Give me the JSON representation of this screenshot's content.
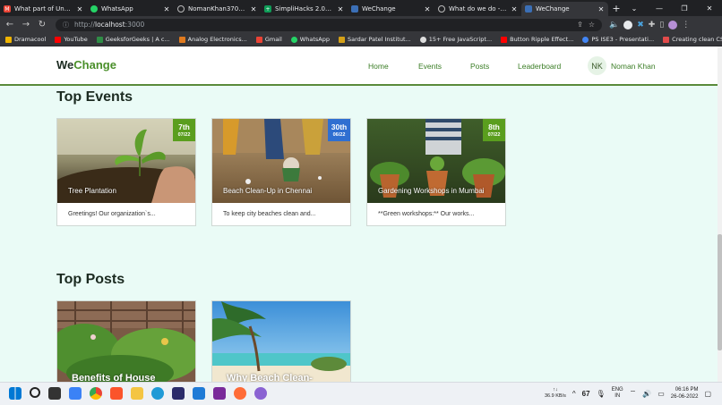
{
  "tabs": [
    {
      "title": "What part of Untitled",
      "icon": "gmail-icon",
      "color": "#ea4335"
    },
    {
      "title": "WhatsApp",
      "icon": "whatsapp-icon",
      "color": "#25d366"
    },
    {
      "title": "NomanKhan3701 (No",
      "icon": "github-icon",
      "color": "#333333"
    },
    {
      "title": "SimpliHacks 2.0 Sche",
      "icon": "sheets-icon",
      "color": "#0f9d58"
    },
    {
      "title": "WeChange",
      "icon": "site-icon",
      "color": "#3b6fb6"
    },
    {
      "title": "What do we do - Ga",
      "icon": "github-icon",
      "color": "#333333"
    },
    {
      "title": "WeChange",
      "icon": "site-icon",
      "color": "#3b6fb6"
    }
  ],
  "url": {
    "scheme": "http://",
    "host": "localhost",
    "port": ":3000"
  },
  "bookmarks": [
    {
      "label": "Dramacool",
      "color": "#f0b400"
    },
    {
      "label": "YouTube",
      "color": "#ff0000"
    },
    {
      "label": "GeeksforGeeks | A c...",
      "color": "#2f8d46"
    },
    {
      "label": "Analog Electronics...",
      "color": "#e07a1e"
    },
    {
      "label": "Gmail",
      "color": "#ea4335"
    },
    {
      "label": "WhatsApp",
      "color": "#25d366"
    },
    {
      "label": "Sardar Patel Institut...",
      "color": "#d4a017"
    },
    {
      "label": "15+ Free JavaScript...",
      "color": "#888888"
    },
    {
      "label": "Button Ripple Effect...",
      "color": "#ff0000"
    },
    {
      "label": "PS ISE3 - Presentati...",
      "color": "#4285f4"
    },
    {
      "label": "Creating clean CSS...",
      "color": "#e24b4b"
    }
  ],
  "site": {
    "brand_we": "We",
    "brand_change": "Change",
    "nav": [
      "Home",
      "Events",
      "Posts",
      "Leaderboard"
    ],
    "user": {
      "initials": "NK",
      "name": "Noman Khan"
    }
  },
  "sections": {
    "events_title": "Top Events",
    "posts_title": "Top Posts"
  },
  "events": [
    {
      "caption": "Tree Plantation",
      "day": "7th",
      "month": "07/22",
      "badge_color": "#5a9e1e",
      "desc": "Greetings! Our organization`s..."
    },
    {
      "caption": "Beach Clean-Up in Chennai",
      "day": "30th",
      "month": "06/22",
      "badge_color": "#2f6fd1",
      "desc": "To keep city beaches clean and..."
    },
    {
      "caption": "Gardening Workshops in Mumbai",
      "day": "8th",
      "month": "07/22",
      "badge_color": "#5a9e1e",
      "desc": "**Green workshops:** Our works..."
    }
  ],
  "posts": [
    {
      "title": "Benefits of House"
    },
    {
      "title": "Why Beach Clean-"
    }
  ],
  "taskbar": {
    "net_top": "↑↓",
    "net_speed": "36.9 KB/s",
    "battery": "67",
    "lang_top": "ENG",
    "lang_bottom": "IN",
    "time": "06:16 PM",
    "date": "26-06-2022"
  }
}
